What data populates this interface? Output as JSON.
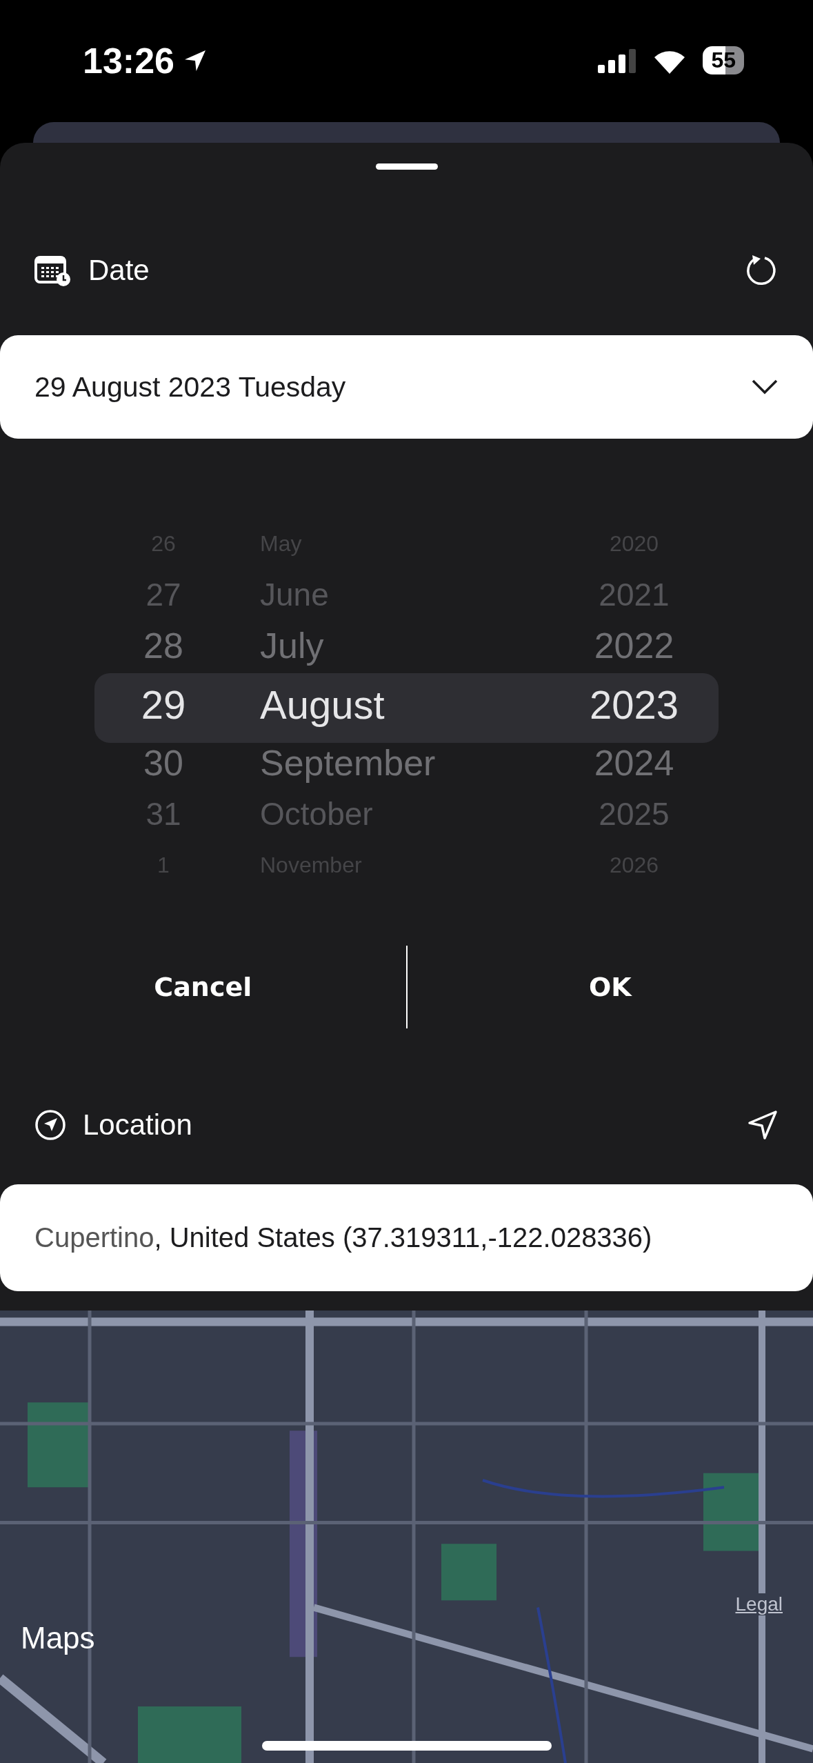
{
  "status_bar": {
    "time": "13:26",
    "battery": "55"
  },
  "date_section": {
    "title": "Date",
    "value": "29 August 2023 Tuesday",
    "expanded": true
  },
  "picker": {
    "columns": [
      {
        "kind": "day",
        "items": [
          {
            "label": "26",
            "selected": false
          },
          {
            "label": "27",
            "selected": false
          },
          {
            "label": "28",
            "selected": false
          },
          {
            "label": "29",
            "selected": true
          },
          {
            "label": "30",
            "selected": false
          },
          {
            "label": "31",
            "selected": false
          },
          {
            "label": "1",
            "selected": false
          }
        ]
      },
      {
        "kind": "month",
        "items": [
          {
            "label": "May",
            "selected": false
          },
          {
            "label": "June",
            "selected": false
          },
          {
            "label": "July",
            "selected": false
          },
          {
            "label": "August",
            "selected": true
          },
          {
            "label": "September",
            "selected": false
          },
          {
            "label": "October",
            "selected": false
          },
          {
            "label": "November",
            "selected": false
          }
        ]
      },
      {
        "kind": "year",
        "items": [
          {
            "label": "2020",
            "selected": false
          },
          {
            "label": "2021",
            "selected": false
          },
          {
            "label": "2022",
            "selected": false
          },
          {
            "label": "2023",
            "selected": true
          },
          {
            "label": "2024",
            "selected": false
          },
          {
            "label": "2025",
            "selected": false
          },
          {
            "label": "2026",
            "selected": false
          }
        ]
      }
    ]
  },
  "buttons": [
    "Cancel",
    "OK"
  ],
  "location_section": {
    "title": "Location",
    "city": "Cupertino",
    "detail": ", United States (37.319311,-122.028336)"
  },
  "map": {
    "kind": "picture",
    "attribution": "Maps",
    "legal": "Legal"
  }
}
